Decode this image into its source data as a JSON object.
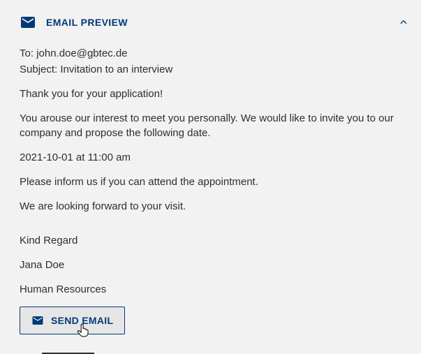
{
  "header": {
    "title": "EMAIL PREVIEW"
  },
  "meta": {
    "to_label": "To:",
    "to_value": "john.doe@gbtec.de",
    "subject_label": "Subject:",
    "subject_value": "Invitation to an interview"
  },
  "body": {
    "greeting": "Thank you for your application!",
    "invite": "You arouse our interest to meet you personally. We would like to invite you to our company and propose the following date.",
    "datetime": "2021-10-01 at 11:00 am",
    "confirm": "Please inform us if you can attend the appointment.",
    "forward": "We are looking forward to your visit.",
    "signoff": "Kind Regard",
    "signer_name": "Jana Doe",
    "signer_role": "Human Resources"
  },
  "actions": {
    "send_label": "SEND EMAIL"
  }
}
